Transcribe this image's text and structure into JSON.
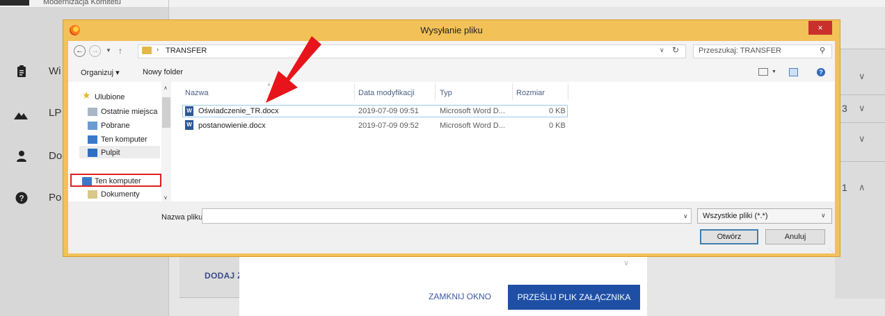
{
  "background": {
    "header_fragment": "Modernizacja Komitetu",
    "sidebar_items": [
      {
        "label": "Wi",
        "icon": "clipboard-icon"
      },
      {
        "label": "LP",
        "icon": "mountain-icon"
      },
      {
        "label": "Do",
        "icon": "person-icon"
      },
      {
        "label": "Po",
        "icon": "help-circle-icon"
      }
    ],
    "right_fragments": [
      "3",
      "1"
    ],
    "add_attachment": "DODAJ ZA",
    "modal": {
      "close_label": "ZAMKNIJ OKNO",
      "send_label": "PRZEŚLIJ PLIK ZAŁĄCZNIKA"
    }
  },
  "dialog": {
    "title": "Wysyłanie pliku",
    "close_symbol": "×",
    "path": "TRANSFER",
    "search_placeholder": "Przeszukaj: TRANSFER",
    "toolbar": {
      "organize": "Organizuj ▾",
      "new_folder": "Nowy folder"
    },
    "nav": [
      {
        "label": "Ulubione",
        "icon": "star-icon"
      },
      {
        "label": "Ostatnie miejsca",
        "icon": "recent-places-icon"
      },
      {
        "label": "Pobrane",
        "icon": "downloads-icon"
      },
      {
        "label": "Ten komputer",
        "icon": "computer-icon"
      },
      {
        "label": "Pulpit",
        "icon": "desktop-icon"
      },
      {
        "label": "Ten komputer",
        "icon": "computer-icon"
      },
      {
        "label": "Dokumenty",
        "icon": "documents-icon"
      }
    ],
    "columns": {
      "name": "Nazwa",
      "date": "Data modyfikacji",
      "type": "Typ",
      "size": "Rozmiar"
    },
    "files": [
      {
        "name": "Oświadczenie_TR.docx",
        "date": "2019-07-09 09:51",
        "type": "Microsoft Word D...",
        "size": "0 KB"
      },
      {
        "name": "postanowienie.docx",
        "date": "2019-07-09 09:52",
        "type": "Microsoft Word D...",
        "size": "0 KB"
      }
    ],
    "filename_label": "Nazwa pliku:",
    "filename_value": "",
    "filetype_value": "Wszystkie pliki (*.*)",
    "open_label": "Otwórz",
    "cancel_label": "Anuluj"
  },
  "colors": {
    "dialog_frame": "#f2c158",
    "close_button": "#c9302c",
    "highlight_box": "#e02020",
    "arrow": "#e8141b",
    "primary_button": "#1f4fa5"
  }
}
